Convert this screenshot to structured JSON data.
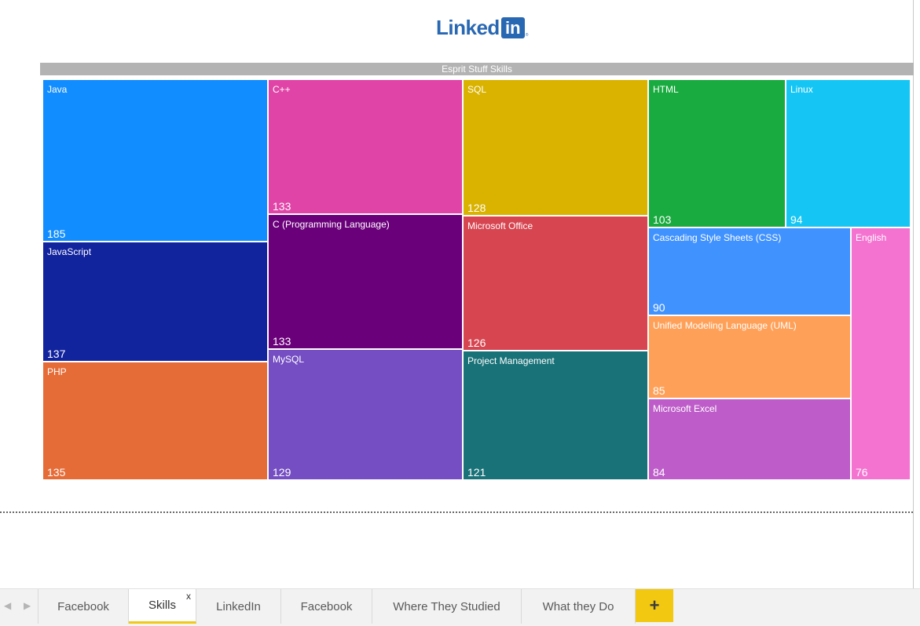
{
  "logo": {
    "text": "Linked",
    "box": "in",
    "mark": "®"
  },
  "chart_data": {
    "type": "treemap",
    "title": "Esprit Stuff Skills",
    "items": [
      {
        "name": "Java",
        "value": 185,
        "color": "#118dff"
      },
      {
        "name": "JavaScript",
        "value": 137,
        "color": "#12239e"
      },
      {
        "name": "PHP",
        "value": 135,
        "color": "#e66c37"
      },
      {
        "name": "C++",
        "value": 133,
        "color": "#e044a7"
      },
      {
        "name": "C (Programming Language)",
        "value": 133,
        "color": "#6b007b"
      },
      {
        "name": "MySQL",
        "value": 129,
        "color": "#744ec2"
      },
      {
        "name": "SQL",
        "value": 128,
        "color": "#d9b300"
      },
      {
        "name": "Microsoft Office",
        "value": 126,
        "color": "#d64550"
      },
      {
        "name": "Project Management",
        "value": 121,
        "color": "#197278"
      },
      {
        "name": "HTML",
        "value": 103,
        "color": "#1aab40"
      },
      {
        "name": "Linux",
        "value": 94,
        "color": "#15c6f4"
      },
      {
        "name": "Cascading Style Sheets (CSS)",
        "value": 90,
        "color": "#4092ff"
      },
      {
        "name": "Unified Modeling Language (UML)",
        "value": 85,
        "color": "#ffa058"
      },
      {
        "name": "Microsoft Excel",
        "value": 84,
        "color": "#be5dc9"
      },
      {
        "name": "English",
        "value": 76,
        "color": "#f472d0"
      }
    ]
  },
  "tabs": [
    {
      "label": "Facebook",
      "active": false
    },
    {
      "label": "Skills",
      "active": true
    },
    {
      "label": "LinkedIn",
      "active": false
    },
    {
      "label": "Facebook",
      "active": false
    },
    {
      "label": "Where They Studied",
      "active": false
    },
    {
      "label": "What they Do",
      "active": false
    }
  ],
  "tab_close": "x",
  "add_tab": "+",
  "nav": {
    "prev": "◀",
    "next": "▶"
  }
}
